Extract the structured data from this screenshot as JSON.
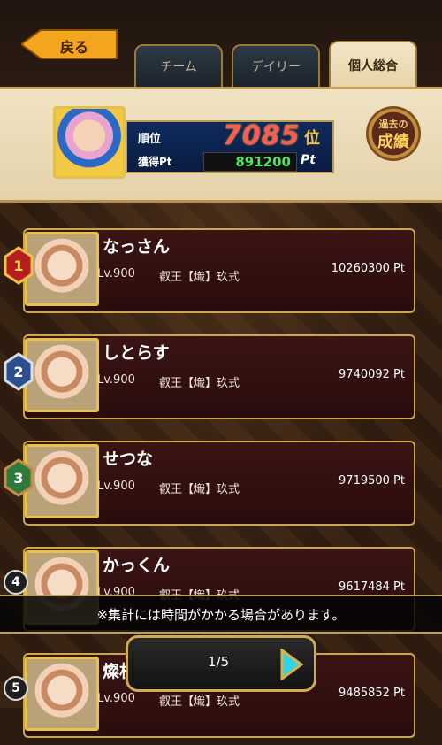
{
  "nav": {
    "back_label": "戻る"
  },
  "tabs": [
    {
      "label": "チーム",
      "active": false
    },
    {
      "label": "デイリー",
      "active": false
    },
    {
      "label": "個人総合",
      "active": true
    }
  ],
  "my_rank": {
    "rank_label": "順位",
    "rank_value": "7085",
    "rank_unit": "位",
    "pt_label": "獲得Pt",
    "pt_value": "891200",
    "pt_unit": "Pt"
  },
  "past_results": {
    "line1": "過去の",
    "line2": "成績"
  },
  "rankings": [
    {
      "rank": "1",
      "name": "なっさん",
      "level": "Lv.900",
      "title": "叡王【熾】玖式",
      "score": "10260300 Pt"
    },
    {
      "rank": "2",
      "name": "しとらす",
      "level": "Lv.900",
      "title": "叡王【熾】玖式",
      "score": "9740092 Pt"
    },
    {
      "rank": "3",
      "name": "せつな",
      "level": "Lv.900",
      "title": "叡王【熾】玖式",
      "score": "9719500 Pt"
    },
    {
      "rank": "4",
      "name": "かっくん",
      "level": "Lv.900",
      "title": "叡王【熾】玖式",
      "score": "9617484 Pt"
    },
    {
      "rank": "5",
      "name": "燦机",
      "level": "Lv.900",
      "title": "叡王【熾】玖式",
      "score": "9485852 Pt"
    }
  ],
  "notice": "※集計には時間がかかる場合があります。",
  "pager": {
    "text": "1/5"
  },
  "colors": {
    "gold": "#c9a654",
    "accent_red": "#ff5a5a",
    "pt_green": "#48e85a"
  }
}
